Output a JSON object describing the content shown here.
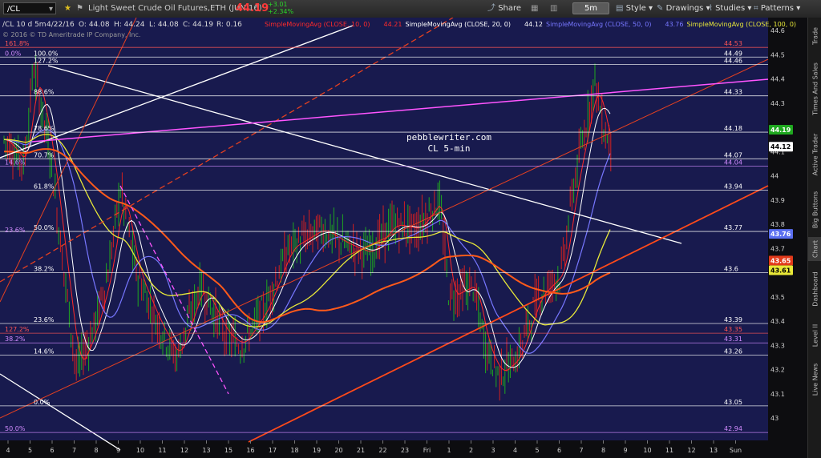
{
  "toolbar": {
    "symbol": "/CL",
    "description": "Light Sweet Crude Oil Futures,ETH (JUN 16)",
    "last_price": "44.19",
    "net_change": "+3.01",
    "pct_change": "+2.34%",
    "share_label": "Share",
    "timeframe": "5m",
    "style_label": "Style",
    "drawings_label": "Drawings",
    "studies_label": "Studies",
    "patterns_label": "Patterns"
  },
  "infobar": {
    "symbol_line": "/CL 10 d 5m",
    "date": "4/22/16",
    "open": "O: 44.08",
    "high": "H: 44.24",
    "low": "L: 44.08",
    "close": "C: 44.19",
    "range": "R: 0.16",
    "copyright": "© 2016 © TD Ameritrade IP Company, Inc.",
    "studies": [
      {
        "label": "SimpleMovingAvg (CLOSE, 10, 0)",
        "value": "44.21",
        "color": "#ff2a2a"
      },
      {
        "label": "SimpleMovingAvg (CLOSE, 20, 0)",
        "value": "44.12",
        "color": "#ffffff"
      },
      {
        "label": "SimpleMovingAvg (CLOSE, 50, 0)",
        "value": "43.76",
        "color": "#7777ff"
      },
      {
        "label": "SimpleMovingAvg (CLOSE, 100, 0)",
        "value": "43.61",
        "color": "#e8e838"
      }
    ]
  },
  "watermark": {
    "line1": "pebblewriter.com",
    "line2": "CL 5-min"
  },
  "price_axis": [
    "44.6",
    "44.5",
    "44.4",
    "44.3",
    "44.2",
    "44.1",
    "44",
    "43.9",
    "43.8",
    "43.7",
    "43.6",
    "43.5",
    "43.4",
    "43.3",
    "43.2",
    "43.1",
    "43"
  ],
  "price_badges": [
    {
      "price": "44.19",
      "color": "#1fa81f",
      "text_color": "#ffffff"
    },
    {
      "price": "44.12",
      "color": "#ffffff",
      "text_color": "#000000"
    },
    {
      "price": "43.76",
      "color": "#5a6ef0",
      "text_color": "#ffffff"
    },
    {
      "price": "43.65",
      "color": "#e23a1a",
      "text_color": "#ffffff"
    },
    {
      "price": "43.61",
      "color": "#e8e838",
      "text_color": "#000000"
    }
  ],
  "time_axis": [
    "4",
    "5",
    "6",
    "7",
    "8",
    "9",
    "10",
    "11",
    "12",
    "13",
    "15",
    "16",
    "17",
    "18",
    "19",
    "20",
    "21",
    "22",
    "23",
    "Fri",
    "1",
    "2",
    "3",
    "4",
    "5",
    "6",
    "7",
    "8",
    "9",
    "10",
    "11",
    "12",
    "13",
    "Sun"
  ],
  "fib_left": [
    {
      "label": "161.8%",
      "price": 44.53,
      "color": "#ff5555"
    },
    {
      "label": "0.0%",
      "price": 44.49,
      "color": "#d28cff"
    },
    {
      "label": "100.0%",
      "price": 44.49,
      "color": "#ffffff"
    },
    {
      "label": "127.2%",
      "price": 44.46,
      "color": "#ffffff"
    },
    {
      "label": "88.6%",
      "price": 44.33,
      "color": "#ffffff"
    },
    {
      "label": "78.6%",
      "price": 44.18,
      "color": "#ffffff"
    },
    {
      "label": "70.7%",
      "price": 44.07,
      "color": "#ffffff"
    },
    {
      "label": "14.6%",
      "price": 44.04,
      "color": "#d28cff"
    },
    {
      "label": "61.8%",
      "price": 43.94,
      "color": "#ffffff"
    },
    {
      "label": "23.6%",
      "price": 43.76,
      "color": "#d28cff"
    },
    {
      "label": "50.0%",
      "price": 43.77,
      "color": "#ffffff"
    },
    {
      "label": "38.2%",
      "price": 43.6,
      "color": "#ffffff"
    },
    {
      "label": "23.6%",
      "price": 43.39,
      "color": "#ffffff"
    },
    {
      "label": "127.2%",
      "price": 43.35,
      "color": "#ff5555"
    },
    {
      "label": "38.2%",
      "price": 43.31,
      "color": "#d28cff"
    },
    {
      "label": "14.6%",
      "price": 43.26,
      "color": "#ffffff"
    },
    {
      "label": "0.0%",
      "price": 43.05,
      "color": "#ffffff"
    },
    {
      "label": "50.0%",
      "price": 42.94,
      "color": "#d28cff"
    }
  ],
  "fib_right": [
    {
      "label": "44.53",
      "price": 44.53,
      "color": "#ff5555"
    },
    {
      "label": "44.49",
      "price": 44.49,
      "color": "#ffffff"
    },
    {
      "label": "44.46",
      "price": 44.46,
      "color": "#ffffff"
    },
    {
      "label": "44.33",
      "price": 44.33,
      "color": "#ffffff"
    },
    {
      "label": "44.18",
      "price": 44.18,
      "color": "#ffffff"
    },
    {
      "label": "44.07",
      "price": 44.07,
      "color": "#ffffff"
    },
    {
      "label": "44.04",
      "price": 44.04,
      "color": "#d28cff"
    },
    {
      "label": "43.94",
      "price": 43.94,
      "color": "#ffffff"
    },
    {
      "label": "43.77",
      "price": 43.77,
      "color": "#ffffff"
    },
    {
      "label": "43.6",
      "price": 43.6,
      "color": "#ffffff"
    },
    {
      "label": "43.39",
      "price": 43.39,
      "color": "#ffffff"
    },
    {
      "label": "43.35",
      "price": 43.35,
      "color": "#ff5555"
    },
    {
      "label": "43.31",
      "price": 43.31,
      "color": "#d28cff"
    },
    {
      "label": "43.26",
      "price": 43.26,
      "color": "#ffffff"
    },
    {
      "label": "43.05",
      "price": 43.05,
      "color": "#ffffff"
    },
    {
      "label": "42.94",
      "price": 42.94,
      "color": "#d28cff"
    }
  ],
  "sidebar": {
    "tabs": [
      "Trade",
      "Times And Sales",
      "Active Trader",
      "Big Buttons",
      "Chart",
      "Dashboard",
      "Level II",
      "Live News"
    ],
    "active": "Chart"
  },
  "colors": {
    "chart_bg": "#181a4e",
    "sma10": "#ff2a2a",
    "sma20": "#ffffff",
    "sma50": "#7777ff",
    "sma100": "#e8e838",
    "sma200": "#ff5a1a",
    "up_bar": "#1fa81f",
    "down_bar": "#d22020"
  }
}
